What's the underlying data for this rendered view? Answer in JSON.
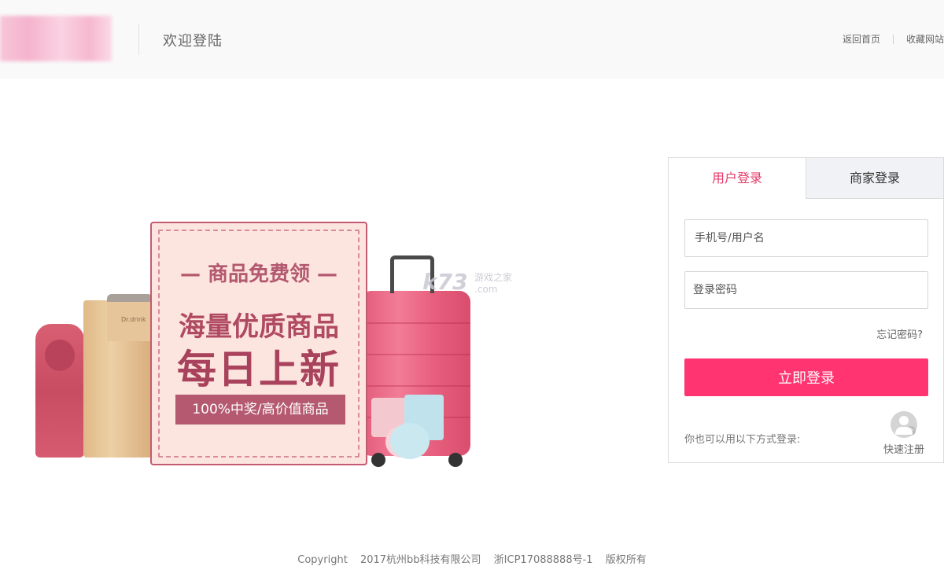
{
  "header": {
    "welcome": "欢迎登陆",
    "links": {
      "home": "返回首页",
      "bookmark": "收藏网站"
    }
  },
  "banner": {
    "subtitle": "— 商品免费领 —",
    "headline1": "海量优质商品",
    "headline2": "每日上新",
    "pill": "100%中奖/高价值商品",
    "machine_label": "Dr.drink",
    "watermark": "k73",
    "watermark_sub": "游戏之家 .com"
  },
  "login": {
    "tabs": [
      "用户登录",
      "商家登录"
    ],
    "username_placeholder": "手机号/用户名",
    "password_placeholder": "登录密码",
    "forgot": "忘记密码?",
    "submit": "立即登录",
    "alt_text": "你也可以用以下方式登录:",
    "quick_register": "快速注册"
  },
  "footer": {
    "copyright": "Copyright",
    "company": "2017杭州bb科技有限公司",
    "icp": "浙ICP17088888号-1",
    "rights": "版权所有"
  },
  "colors": {
    "accent": "#ff3470",
    "tab_active": "#e63b6a",
    "card_bg": "#fde5df",
    "card_text": "#b04a63"
  }
}
